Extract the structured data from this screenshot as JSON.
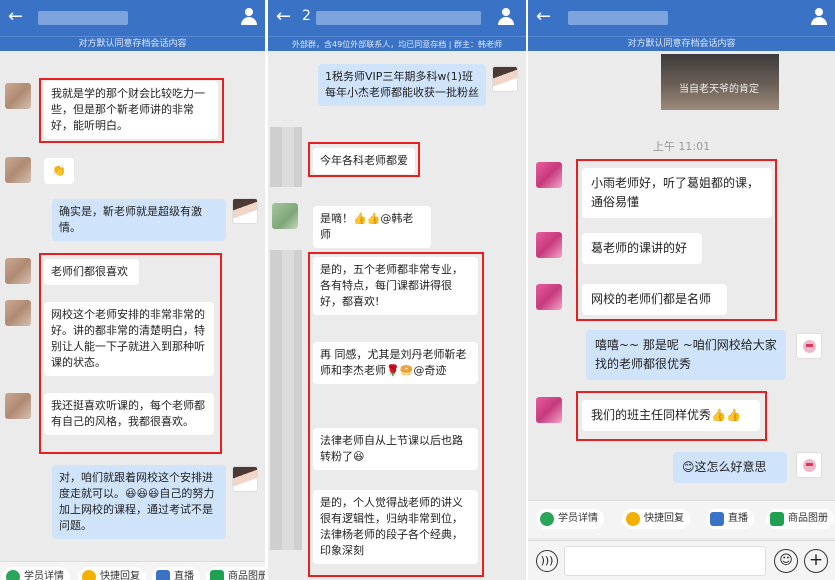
{
  "panel1": {
    "back": "←",
    "subheader": "对方默认同意存档会话内容",
    "top_cut": "",
    "msg1": "我就是学的那个财会比较吃力一些，但是那个靳老师讲的非常好，能听明白。",
    "msg2": "👏",
    "msg3": "确实是，靳老师就是超级有激情。",
    "msg4": "老师们都很喜欢",
    "msg5": "网校这个老师安排的非常非常的好。讲的都非常的清楚明白，特别让人能一下子就进入到那种听课的状态。",
    "msg6": "我还挺喜欢听课的，每个老师都有自己的风格，我都很喜欢。",
    "msg7": "对，咱们就跟着网校这个安排进度走就可以。😆😆😆自己的努力加上网校的课程，通过考试不是问题。",
    "toolbar": [
      "学员详情",
      "快捷回复",
      "直播",
      "商品图册"
    ]
  },
  "panel2": {
    "back": "←",
    "title_prefix": "2",
    "subheader": "外部群，含49位外部联系人，均已同意存档 | 群主：韩老师",
    "msg1": "1税务师VIP三年期多科w(1)班 每年小杰老师都能收获一批粉丝",
    "msg2": "今年各科老师都爱",
    "msg3": "是嘀！👍👍@韩老师",
    "msg4": "是的，五个老师都非常专业，各有特点，每门课都讲得很好，都喜欢!",
    "msg5": "再 同感，尤其是刘丹老师靳老师和李杰老师🌹🥯@奇迹",
    "msg6": "法律老师自从上节课以后也路转粉了😆",
    "msg7": "是的，个人觉得战老师的讲义很有逻辑性，归纳非常到位，法律杨老师的段子各个经典，印象深刻"
  },
  "panel3": {
    "back": "←",
    "subheader": "对方默认同意存档会话内容",
    "photo_caption": "当自老天爷的肯定",
    "time": "上午 11:01",
    "msg1": "小雨老师好，听了葛姐都的课，通俗易懂",
    "msg2": "葛老师的课讲的好",
    "msg3": "网校的老师们都是名师",
    "msg4": "嘻嘻~~ 那是呢 ~咱们网校给大家找的老师都很优秀",
    "msg5": "我们的班主任同样优秀👍👍",
    "msg6": "😊这怎么好意思",
    "toolbar": [
      "学员详情",
      "快捷回复",
      "直播",
      "商品图册"
    ]
  }
}
